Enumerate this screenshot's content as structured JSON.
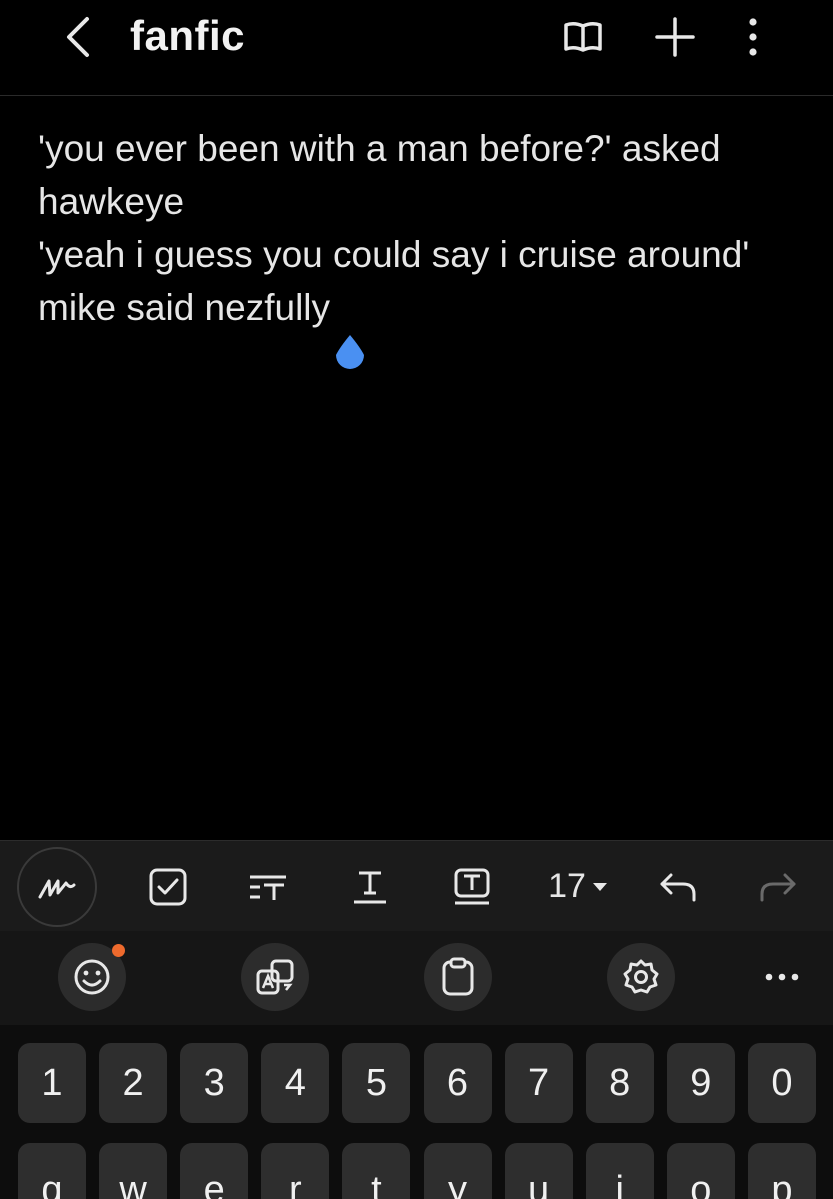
{
  "header": {
    "title": "fanfic",
    "back_icon": "chevron-left-icon",
    "actions": [
      "book-open-icon",
      "plus-icon",
      "more-vertical-icon"
    ]
  },
  "note": {
    "lines": [
      "'you ever been with a man before?' asked",
      "hawkeye",
      "'yeah i guess you could say i cruise around'",
      "mike said nezfully"
    ]
  },
  "toolbar": {
    "font_size": "17",
    "icons": [
      "handwriting-icon",
      "checkbox-icon",
      "text-style-icon",
      "underline-text-icon",
      "text-color-icon",
      "undo-icon",
      "redo-icon"
    ]
  },
  "keyboard_bar": {
    "icons": [
      "emoji-icon",
      "translate-icon",
      "clipboard-icon",
      "settings-icon",
      "more-horizontal-icon"
    ],
    "badge_color": "#ee6a2d"
  },
  "keyboard": {
    "number_row": [
      "1",
      "2",
      "3",
      "4",
      "5",
      "6",
      "7",
      "8",
      "9",
      "0"
    ],
    "letter_row": [
      "q",
      "w",
      "e",
      "r",
      "t",
      "y",
      "u",
      "i",
      "o",
      "p"
    ]
  },
  "colors": {
    "accent": "#4a90f2",
    "background": "#000000",
    "toolbar": "#1b1b1b",
    "key": "#2e2e2e"
  }
}
